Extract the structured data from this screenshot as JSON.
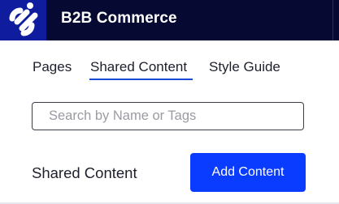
{
  "header": {
    "app_title": "B2B Commerce",
    "logo_icon": "brand-logo-icon",
    "bar_color": "#060a33",
    "logo_tile_color": "#0f1c9e"
  },
  "tabs": [
    {
      "label": "Pages",
      "active": false
    },
    {
      "label": "Shared Content",
      "active": true
    },
    {
      "label": "Style Guide",
      "active": false
    }
  ],
  "search": {
    "value": "",
    "placeholder": "Search by Name or Tags"
  },
  "section": {
    "title": "Shared Content",
    "add_button_label": "Add Content"
  },
  "colors": {
    "accent": "#0a3cff",
    "tab_underline": "#1a4bd6",
    "text": "#1d1f2c"
  }
}
